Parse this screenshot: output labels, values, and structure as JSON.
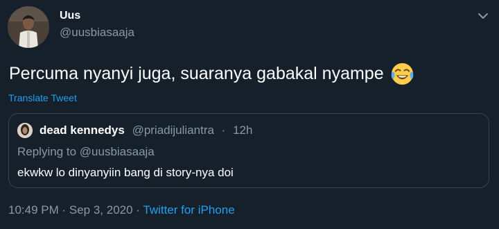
{
  "author": {
    "display_name": "Uus",
    "handle": "@uusbiasaaja"
  },
  "tweet": {
    "text": "Percuma nyanyi juga, suaranya gabakal nyampe",
    "emoji": "face-with-tears-of-joy",
    "translate_label": "Translate Tweet"
  },
  "quote": {
    "display_name": "dead kennedys",
    "handle": "@priadijuliantra",
    "separator": "·",
    "time": "12h",
    "replying_to": "Replying to @uusbiasaaja",
    "text": "ekwkw lo dinyanyiin bang di story-nya doi"
  },
  "meta": {
    "time": "10:49 PM",
    "separator": " · ",
    "date": "Sep 3, 2020",
    "source": "Twitter for iPhone"
  },
  "colors": {
    "background": "#15202b",
    "secondary_text": "#8899a6",
    "link": "#1da1f2",
    "border": "#38444d"
  }
}
